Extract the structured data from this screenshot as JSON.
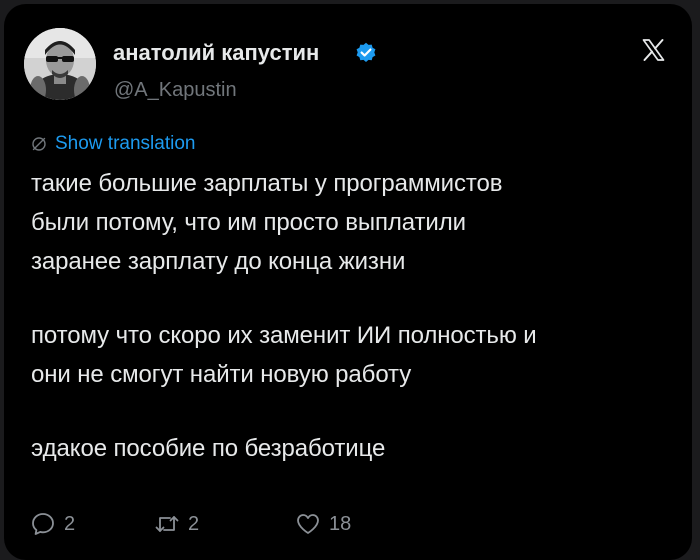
{
  "author": {
    "display_name": "анатолий капустин",
    "handle": "@A_Kapustin"
  },
  "translate": {
    "label": "Show translation"
  },
  "tweet": {
    "lines": [
      "такие большие зарплаты у программистов",
      "были потому, что им просто выплатили",
      "заранее зарплату до конца жизни",
      "потому что скоро их заменит ИИ полностью и",
      "они не смогут найти новую работу",
      "эдакое пособие по безработице"
    ]
  },
  "metrics": {
    "replies": "2",
    "reposts": "2",
    "likes": "18"
  },
  "colors": {
    "background": "#000000",
    "text": "#e7e9ea",
    "muted": "#71767b",
    "accent": "#1d9bf0"
  },
  "icons": {
    "verified": "verified-badge-icon",
    "brand": "x-logo-icon",
    "translate": "globe-slash-icon",
    "reply": "speech-bubble-icon",
    "repost": "repost-arrows-icon",
    "like": "heart-icon"
  }
}
